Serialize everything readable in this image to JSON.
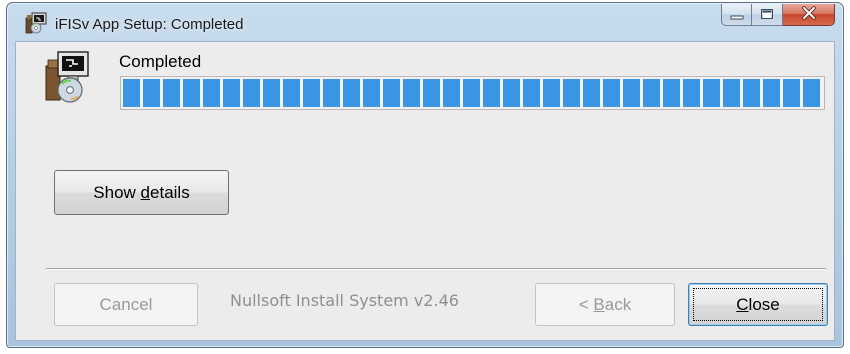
{
  "window": {
    "title": "iFISv App Setup: Completed"
  },
  "titlebar_buttons": {
    "minimize_icon": "minimize-icon",
    "maximize_icon": "maximize-icon",
    "close_icon": "close-x-icon"
  },
  "header": {
    "status": "Completed",
    "icon": "installer-disk-icon"
  },
  "progress": {
    "value_percent": 100,
    "color": "#3b95e6"
  },
  "details_button": {
    "before": "Show ",
    "mnemonic": "d",
    "after": "etails"
  },
  "footer": {
    "branding": "Nullsoft Install System v2.46",
    "cancel_label": "Cancel",
    "back": {
      "before": "< ",
      "mnemonic": "B",
      "after": "ack"
    },
    "close": {
      "mnemonic": "C",
      "after": "lose"
    }
  }
}
